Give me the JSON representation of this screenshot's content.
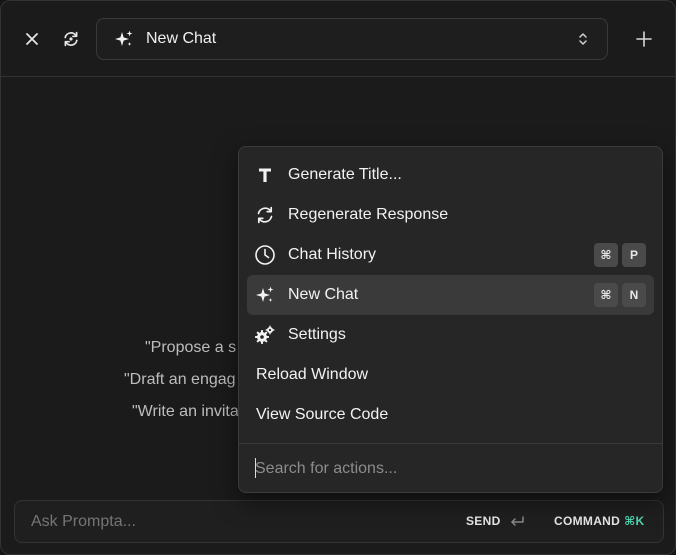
{
  "header": {
    "chat_title": "New Chat",
    "icons": {
      "close": "close-icon",
      "refresh": "refresh-icon",
      "sparkle": "sparkle-icon",
      "chevron": "updown-chevron-icon",
      "add": "plus-icon"
    }
  },
  "suggestions": [
    "\"Propose a s",
    "\"Draft an engag",
    "\"Write an invita"
  ],
  "composer": {
    "placeholder": "Ask Prompta...",
    "send_label": "SEND",
    "command_label": "COMMAND",
    "command_key": "⌘K"
  },
  "menu": {
    "items": [
      {
        "label": "Generate Title...",
        "icon": "title-t-icon"
      },
      {
        "label": "Regenerate Response",
        "icon": "regenerate-icon"
      },
      {
        "label": "Chat History",
        "icon": "history-clock-icon",
        "shortcut": [
          "⌘",
          "P"
        ]
      },
      {
        "label": "New Chat",
        "icon": "sparkle-icon",
        "shortcut": [
          "⌘",
          "N"
        ],
        "active": true
      },
      {
        "label": "Settings",
        "icon": "gears-icon"
      },
      {
        "label": "Reload Window"
      },
      {
        "label": "View Source Code"
      }
    ],
    "search_placeholder": "Search for actions..."
  },
  "colors": {
    "accent": "#4fd6b2",
    "background": "#1b1b1b",
    "menu_bg": "#262626",
    "active_bg": "#3a3a3a"
  }
}
